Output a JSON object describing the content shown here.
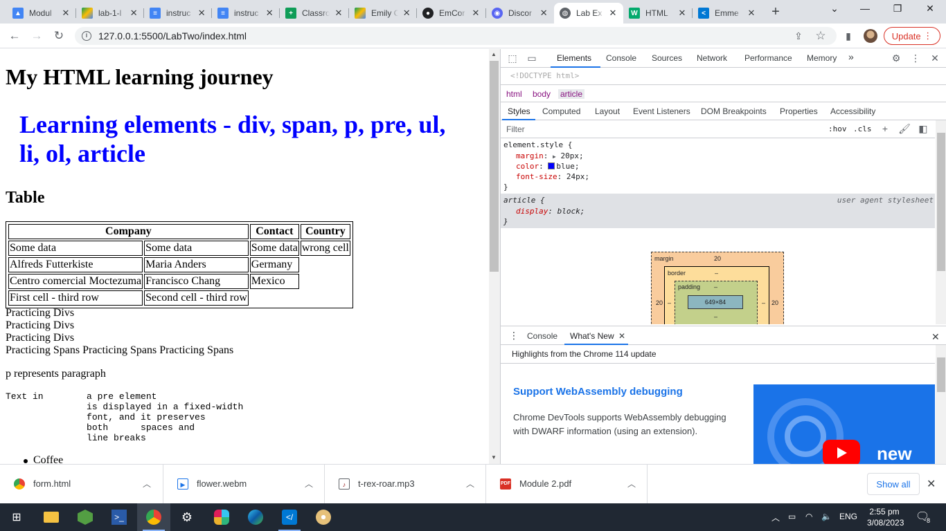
{
  "browser": {
    "tabs": [
      {
        "title": "Modul",
        "icon": "google-drive-blue-icon"
      },
      {
        "title": "lab-1-l",
        "icon": "google-drive-icon"
      },
      {
        "title": "instruc",
        "icon": "google-docs-icon"
      },
      {
        "title": "instruc",
        "icon": "google-docs-icon"
      },
      {
        "title": "Classro",
        "icon": "google-sheets-icon"
      },
      {
        "title": "Emily C",
        "icon": "google-drive-icon"
      },
      {
        "title": "EmCor",
        "icon": "github-icon"
      },
      {
        "title": "Discor",
        "icon": "discord-icon"
      },
      {
        "title": "Lab Ex",
        "icon": "globe-icon",
        "active": true
      },
      {
        "title": "HTML",
        "icon": "w3schools-icon"
      },
      {
        "title": "Emme",
        "icon": "vscode-icon"
      }
    ],
    "url": "127.0.0.1:5500/LabTwo/index.html",
    "update_label": "Update"
  },
  "page": {
    "h1": "My HTML learning journey",
    "article_heading": "Learning elements - div, span, p, pre, ul, li, ol, article",
    "table_heading": "Table",
    "table": {
      "headers": [
        "Company",
        "Contact",
        "Country"
      ],
      "rows": [
        [
          "Some data",
          "Some data",
          "Some data",
          "wrong cell"
        ],
        [
          "Alfreds Futterkiste",
          "Maria Anders",
          "Germany"
        ],
        [
          "Centro comercial Moctezuma",
          "Francisco Chang",
          "Mexico"
        ],
        [
          "First cell - third row",
          "Second cell - third row"
        ]
      ]
    },
    "divs": [
      "Practicing Divs",
      "Practicing Divs",
      "Practicing Divs"
    ],
    "spans": "Practicing Spans Practicing Spans Practicing Spans",
    "paragraph": "p represents paragraph",
    "pre": "Text in        a pre element\n               is displayed in a fixed-width\n               font, and it preserves\n               both      spaces and\n               line breaks",
    "list_item": "Coffee"
  },
  "devtools": {
    "tabs": [
      "Elements",
      "Console",
      "Sources",
      "Network",
      "Performance",
      "Memory"
    ],
    "more": "»",
    "doctype": "<!DOCTYPE html>",
    "breadcrumbs": [
      "html",
      "body",
      "article"
    ],
    "subtabs": [
      "Styles",
      "Computed",
      "Layout",
      "Event Listeners",
      "DOM Breakpoints",
      "Properties",
      "Accessibility"
    ],
    "filter_placeholder": "Filter",
    "hov": ":hov",
    "cls": ".cls",
    "element_style": {
      "selector": "element.style {",
      "props": [
        {
          "name": "margin",
          "value": "20px;"
        },
        {
          "name": "color",
          "value": "blue;"
        },
        {
          "name": "font-size",
          "value": "24px;"
        }
      ],
      "close": "}"
    },
    "ua_rule": {
      "selector": "article {",
      "source": "user agent stylesheet",
      "prop": "display",
      "value": "block;",
      "close": "}"
    },
    "box_model": {
      "margin_label": "margin",
      "margin_top": "20",
      "margin_left": "20",
      "margin_right": "20",
      "border_label": "border",
      "border_value": "–",
      "padding_label": "padding",
      "padding_value": "–",
      "content": "649×84"
    },
    "drawer": {
      "tabs": [
        "Console",
        "What's New"
      ],
      "highlights": "Highlights from the Chrome 114 update",
      "feature_title": "Support WebAssembly debugging",
      "feature_desc": "Chrome DevTools supports WebAssembly debugging with DWARF information (using an extension).",
      "image_text": "new"
    }
  },
  "downloads": {
    "items": [
      {
        "name": "form.html",
        "icon": "chrome-icon"
      },
      {
        "name": "flower.webm",
        "icon": "video-file-icon"
      },
      {
        "name": "t-rex-roar.mp3",
        "icon": "audio-file-icon"
      },
      {
        "name": "Module 2.pdf",
        "icon": "pdf-file-icon"
      }
    ],
    "show_all": "Show all"
  },
  "taskbar": {
    "language": "ENG",
    "time": "2:55 pm",
    "date": "3/08/2023",
    "notifications": "8"
  }
}
